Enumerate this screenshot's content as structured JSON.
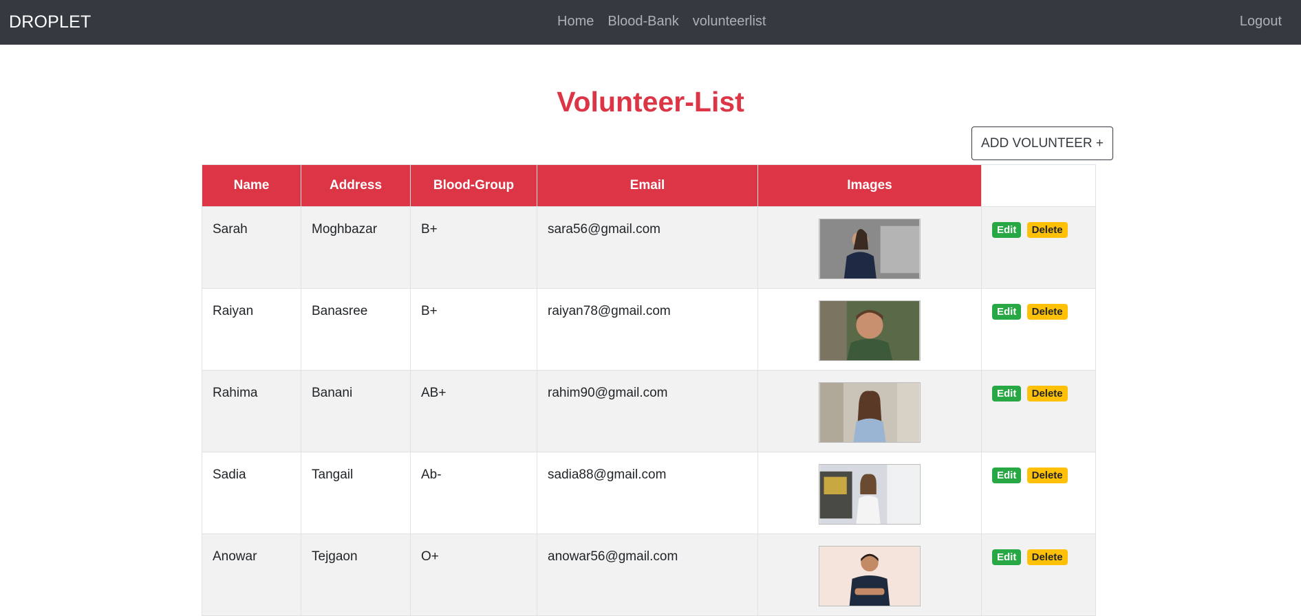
{
  "navbar": {
    "brand": "DROPLET",
    "links": [
      "Home",
      "Blood-Bank",
      "volunteerlist"
    ],
    "logout": "Logout"
  },
  "page": {
    "title": "Volunteer-List",
    "add_button": "ADD VOLUNTEER +"
  },
  "table": {
    "headers": [
      "Name",
      "Address",
      "Blood-Group",
      "Email",
      "Images"
    ],
    "rows": [
      {
        "name": "Sarah",
        "address": "Moghbazar",
        "blood": "B+",
        "email": "sara56@gmail.com"
      },
      {
        "name": "Raiyan",
        "address": "Banasree",
        "blood": "B+",
        "email": "raiyan78@gmail.com"
      },
      {
        "name": "Rahima",
        "address": "Banani",
        "blood": "AB+",
        "email": "rahim90@gmail.com"
      },
      {
        "name": "Sadia",
        "address": "Tangail",
        "blood": "Ab-",
        "email": "sadia88@gmail.com"
      },
      {
        "name": "Anowar",
        "address": "Tejgaon",
        "blood": "O+",
        "email": "anowar56@gmail.com"
      }
    ],
    "edit_label": "Edit",
    "delete_label": "Delete"
  },
  "colors": {
    "navbar_bg": "#343a40",
    "accent_red": "#dc3545",
    "edit_green": "#28a745",
    "delete_yellow": "#ffc107"
  }
}
